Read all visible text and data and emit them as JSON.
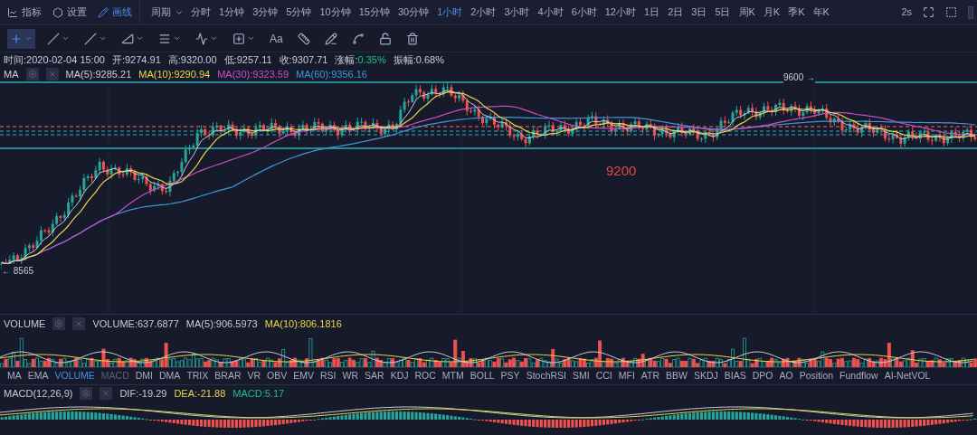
{
  "toolbar": {
    "buttons": [
      {
        "label": "指标",
        "selected": false
      },
      {
        "label": "设置",
        "selected": false
      },
      {
        "label": "画线",
        "selected": true
      }
    ],
    "period_label": "周期",
    "periods": [
      {
        "label": "分时",
        "selected": false
      },
      {
        "label": "1分钟",
        "selected": false
      },
      {
        "label": "3分钟",
        "selected": false
      },
      {
        "label": "5分钟",
        "selected": false
      },
      {
        "label": "10分钟",
        "selected": false
      },
      {
        "label": "15分钟",
        "selected": false
      },
      {
        "label": "30分钟",
        "selected": false
      },
      {
        "label": "1小时",
        "selected": true
      },
      {
        "label": "2小时",
        "selected": false
      },
      {
        "label": "3小时",
        "selected": false
      },
      {
        "label": "4小时",
        "selected": false
      },
      {
        "label": "6小时",
        "selected": false
      },
      {
        "label": "12小时",
        "selected": false
      },
      {
        "label": "1日",
        "selected": false
      },
      {
        "label": "2日",
        "selected": false
      },
      {
        "label": "3日",
        "selected": false
      },
      {
        "label": "5日",
        "selected": false
      },
      {
        "label": "周K",
        "selected": false
      },
      {
        "label": "月K",
        "selected": false
      },
      {
        "label": "季K",
        "selected": false
      },
      {
        "label": "年K",
        "selected": false
      }
    ],
    "refresh": "2s"
  },
  "drawing_tools": [
    {
      "selected": true,
      "has_menu": true
    },
    {
      "selected": false,
      "has_menu": true
    },
    {
      "selected": false,
      "has_menu": true
    },
    {
      "selected": false,
      "has_menu": true
    },
    {
      "selected": false,
      "has_menu": true
    },
    {
      "selected": false,
      "has_menu": true
    },
    {
      "selected": false,
      "has_menu": true
    },
    {
      "selected": false,
      "has_menu": false,
      "label": "Aa"
    },
    {
      "selected": false,
      "has_menu": false
    },
    {
      "selected": false,
      "has_menu": false
    },
    {
      "selected": false,
      "has_menu": false
    },
    {
      "selected": false,
      "has_menu": false
    },
    {
      "selected": false,
      "has_menu": false
    }
  ],
  "info": [
    {
      "label": "时间:",
      "value": "2020-02-04 15:00"
    },
    {
      "label": "开:",
      "value": "9274.91"
    },
    {
      "label": "高:",
      "value": "9320.00"
    },
    {
      "label": "低:",
      "value": "9257.11"
    },
    {
      "label": "收:",
      "value": "9307.71"
    },
    {
      "label": "涨幅:",
      "value": "0.35%",
      "color": "#1fbf8f"
    },
    {
      "label": "振幅:",
      "value": "0.68%"
    }
  ],
  "main_panel": {
    "name": "MA",
    "values": [
      {
        "text": "MA(5):9285.21",
        "color": "#c8ccd8"
      },
      {
        "text": "MA(10):9290.94",
        "color": "#e8d84a"
      },
      {
        "text": "MA(30):9323.59",
        "color": "#c84fc8"
      },
      {
        "text": "MA(60):9356.16",
        "color": "#3a9ad9"
      }
    ],
    "annotations": {
      "high": "9600 →",
      "level": "9200",
      "low": "← 8565"
    }
  },
  "volume_panel": {
    "name": "VOLUME",
    "values": [
      {
        "text": "VOLUME:637.6877",
        "color": "#c8ccd8"
      },
      {
        "text": "MA(5):906.5973",
        "color": "#c8ccd8"
      },
      {
        "text": "MA(10):806.1816",
        "color": "#e8d84a"
      }
    ]
  },
  "indicator_tabs": [
    {
      "label": "MA",
      "selected": false,
      "open": false
    },
    {
      "label": "EMA",
      "selected": false,
      "open": false
    },
    {
      "label": "VOLUME",
      "selected": true,
      "open": false
    },
    {
      "label": "MACD",
      "selected": false,
      "open": true
    },
    {
      "label": "DMI",
      "selected": false,
      "open": false
    },
    {
      "label": "DMA",
      "selected": false,
      "open": false
    },
    {
      "label": "TRIX",
      "selected": false,
      "open": false
    },
    {
      "label": "BRAR",
      "selected": false,
      "open": false
    },
    {
      "label": "VR",
      "selected": false,
      "open": false
    },
    {
      "label": "OBV",
      "selected": false,
      "open": false
    },
    {
      "label": "EMV",
      "selected": false,
      "open": false
    },
    {
      "label": "RSI",
      "selected": false,
      "open": false
    },
    {
      "label": "WR",
      "selected": false,
      "open": false
    },
    {
      "label": "SAR",
      "selected": false,
      "open": false
    },
    {
      "label": "KDJ",
      "selected": false,
      "open": false
    },
    {
      "label": "ROC",
      "selected": false,
      "open": false
    },
    {
      "label": "MTM",
      "selected": false,
      "open": false
    },
    {
      "label": "BOLL",
      "selected": false,
      "open": false
    },
    {
      "label": "PSY",
      "selected": false,
      "open": false
    },
    {
      "label": "StochRSI",
      "selected": false,
      "open": false
    },
    {
      "label": "SMI",
      "selected": false,
      "open": false
    },
    {
      "label": "CCI",
      "selected": false,
      "open": false
    },
    {
      "label": "MFI",
      "selected": false,
      "open": false
    },
    {
      "label": "ATR",
      "selected": false,
      "open": false
    },
    {
      "label": "BBW",
      "selected": false,
      "open": false
    },
    {
      "label": "SKDJ",
      "selected": false,
      "open": false
    },
    {
      "label": "BIAS",
      "selected": false,
      "open": false
    },
    {
      "label": "DPO",
      "selected": false,
      "open": false
    },
    {
      "label": "AO",
      "selected": false,
      "open": false
    },
    {
      "label": "Position",
      "selected": false,
      "open": false
    },
    {
      "label": "Fundflow",
      "selected": false,
      "open": false
    },
    {
      "label": "AI-NetVOL",
      "selected": false,
      "open": false
    }
  ],
  "macd_panel": {
    "name": "MACD(12,26,9)",
    "values": [
      {
        "text": "DIF:-19.29",
        "color": "#c8ccd8"
      },
      {
        "text": "DEA:-21.88",
        "color": "#e8d84a"
      },
      {
        "text": "MACD:5.17",
        "color": "#1fbf8f"
      }
    ]
  }
}
